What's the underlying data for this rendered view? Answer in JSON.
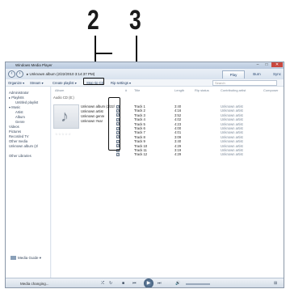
{
  "callouts": [
    "2",
    "3"
  ],
  "window": {
    "title": "Windows Media Player",
    "controls": {
      "minimize": "–",
      "maximize": "□",
      "close": "✕"
    }
  },
  "nav": {
    "back_icon": "arrow-left-icon",
    "forward_icon": "arrow-right-icon",
    "breadcrumb": "▸ Unknown album (2/22/2010 3:14:37 PM)",
    "tabs": [
      "Play",
      "Burn",
      "Sync"
    ]
  },
  "toolbar": {
    "organize": "Organize ▾",
    "stream": "Stream ▾",
    "create_playlist": "Create playlist ▾",
    "stop_rip": "Stop rip CD",
    "rip_settings": "Rip settings ▾",
    "search_placeholder": "Search"
  },
  "sidebar": {
    "items": [
      "Administrator",
      "▸ Playlists",
      "Untitled playlist",
      "▾ Music",
      "Artist",
      "Album",
      "Genre",
      "Videos",
      "Pictures",
      "Recorded TV",
      "Other media",
      "Unknown album (2/",
      "Other Libraries"
    ],
    "media_guide": "Media Guide ▾"
  },
  "columns": [
    "Album",
    "#",
    "Title",
    "Length",
    "Rip status",
    "Contributing artist",
    "Composer"
  ],
  "album": {
    "label": "Audio CD (E:)",
    "meta": [
      "Unknown album (2/22/",
      "Unknown artist",
      "Unknown genre",
      "Unknown Year"
    ],
    "rating": "☆☆☆☆☆"
  },
  "tracks": [
    {
      "title": "Track 1",
      "length": "3:40",
      "artist": "Unknown artist"
    },
    {
      "title": "Track 2",
      "length": "4:16",
      "artist": "Unknown artist"
    },
    {
      "title": "Track 3",
      "length": "3:52",
      "artist": "Unknown artist"
    },
    {
      "title": "Track 4",
      "length": "4:02",
      "artist": "Unknown artist"
    },
    {
      "title": "Track 5",
      "length": "4:23",
      "artist": "Unknown artist"
    },
    {
      "title": "Track 6",
      "length": "4:00",
      "artist": "Unknown artist"
    },
    {
      "title": "Track 7",
      "length": "4:01",
      "artist": "Unknown artist"
    },
    {
      "title": "Track 8",
      "length": "3:09",
      "artist": "Unknown artist"
    },
    {
      "title": "Track 9",
      "length": "3:40",
      "artist": "Unknown artist"
    },
    {
      "title": "Track 10",
      "length": "4:29",
      "artist": "Unknown artist"
    },
    {
      "title": "Track 11",
      "length": "3:19",
      "artist": "Unknown artist"
    },
    {
      "title": "Track 12",
      "length": "4:29",
      "artist": "Unknown artist"
    }
  ],
  "player": {
    "status": "Media changing...",
    "shuffle": "⤮",
    "repeat": "↻",
    "stop": "■",
    "prev": "⏮",
    "play": "▶",
    "next": "⏭",
    "mute": "🔊",
    "switch": "⊞"
  }
}
